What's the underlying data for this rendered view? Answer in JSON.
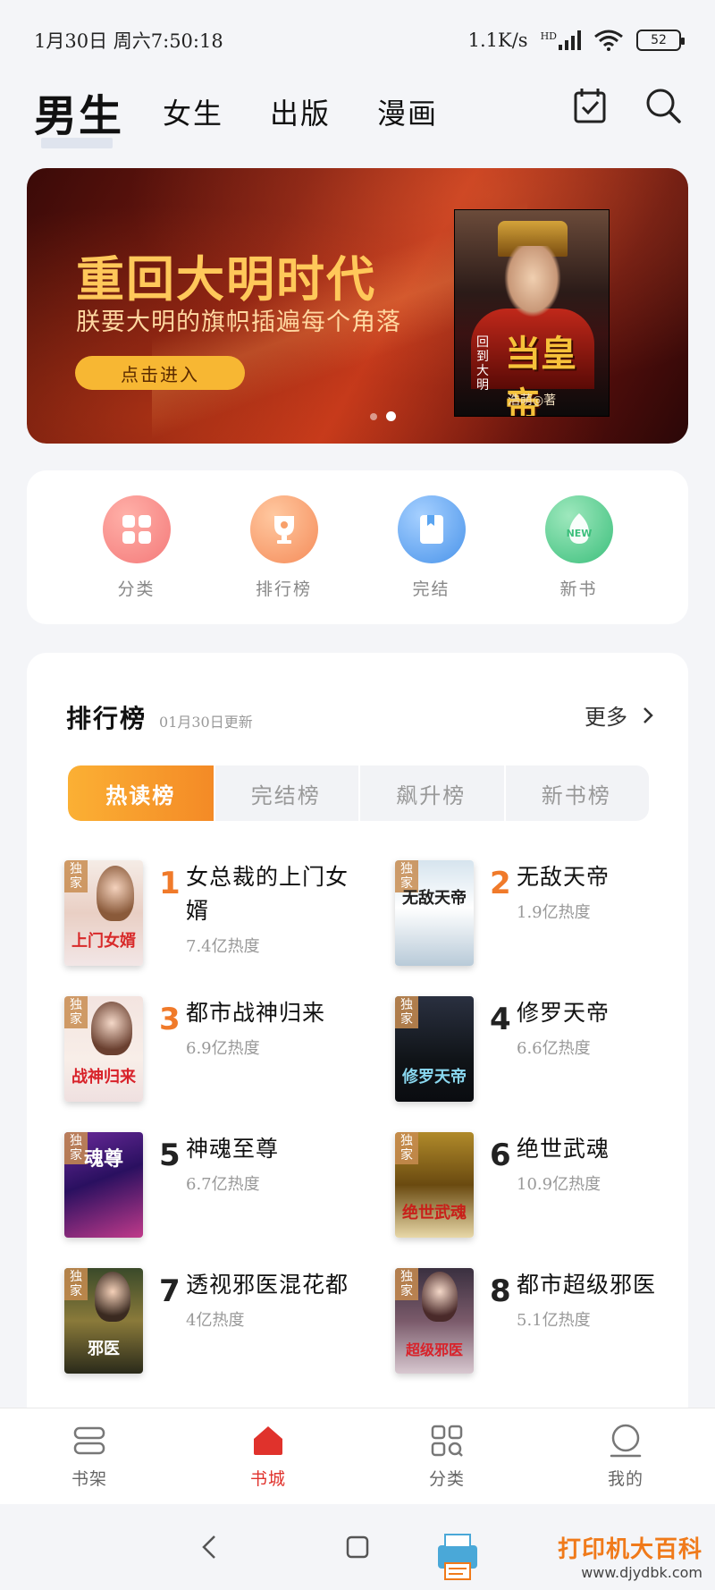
{
  "status_bar": {
    "datetime": "1月30日 周六7:50:18",
    "speed": "1.1K/s",
    "network": "HD",
    "battery": "52"
  },
  "top_tabs": [
    "男生",
    "女生",
    "出版",
    "漫画"
  ],
  "banner": {
    "title": "重回大明时代",
    "subtitle": "朕要大明的旗帜插遍每个角落",
    "button": "点击进入",
    "cover_title": "当皇帝",
    "cover_side": "回到大明",
    "cover_author": "浩萌◎著"
  },
  "categories": [
    {
      "label": "分类",
      "color": "#f47a7a",
      "icon": "grid-icon"
    },
    {
      "label": "排行榜",
      "color": "#f8a06a",
      "icon": "trophy-icon"
    },
    {
      "label": "完结",
      "color": "#5aa4f0",
      "icon": "book-icon"
    },
    {
      "label": "新书",
      "color": "#4cc98a",
      "icon": "new-icon"
    }
  ],
  "ranking": {
    "title": "排行榜",
    "date": "01月30日更新",
    "more": "更多",
    "tabs": [
      "热读榜",
      "完结榜",
      "飙升榜",
      "新书榜"
    ],
    "books": [
      {
        "rank": "1",
        "title": "女总裁的上门女婿",
        "heat": "7.4亿热度",
        "tag": "独家",
        "cover_text": "上门女婿"
      },
      {
        "rank": "2",
        "title": "无敌天帝",
        "heat": "1.9亿热度",
        "tag": "独家",
        "cover_text": "无敌天帝"
      },
      {
        "rank": "3",
        "title": "都市战神归来",
        "heat": "6.9亿热度",
        "tag": "独家",
        "cover_text": "战神归来"
      },
      {
        "rank": "4",
        "title": "修罗天帝",
        "heat": "6.6亿热度",
        "tag": "独家",
        "cover_text": "修罗天帝"
      },
      {
        "rank": "5",
        "title": "神魂至尊",
        "heat": "6.7亿热度",
        "tag": "独家",
        "cover_text": "魂尊"
      },
      {
        "rank": "6",
        "title": "绝世武魂",
        "heat": "10.9亿热度",
        "tag": "独家",
        "cover_text": "绝世武魂"
      },
      {
        "rank": "7",
        "title": "透视邪医混花都",
        "heat": "4亿热度",
        "tag": "独家",
        "cover_text": "邪医"
      },
      {
        "rank": "8",
        "title": "都市超级邪医",
        "heat": "5.1亿热度",
        "tag": "独家",
        "cover_text": "超级邪医"
      }
    ]
  },
  "bottom_nav": [
    {
      "label": "书架",
      "icon": "bookshelf-icon"
    },
    {
      "label": "书城",
      "icon": "home-icon",
      "active": true
    },
    {
      "label": "分类",
      "icon": "category-icon"
    },
    {
      "label": "我的",
      "icon": "profile-icon"
    }
  ],
  "watermark": {
    "line1": "打印机大百科",
    "line2": "www.djydbk.com"
  },
  "colors": {
    "accent_red": "#e0322c",
    "rank_orange": "#f07a2a",
    "tab_gradient_start": "#fbb034",
    "tab_gradient_end": "#f48a26"
  }
}
